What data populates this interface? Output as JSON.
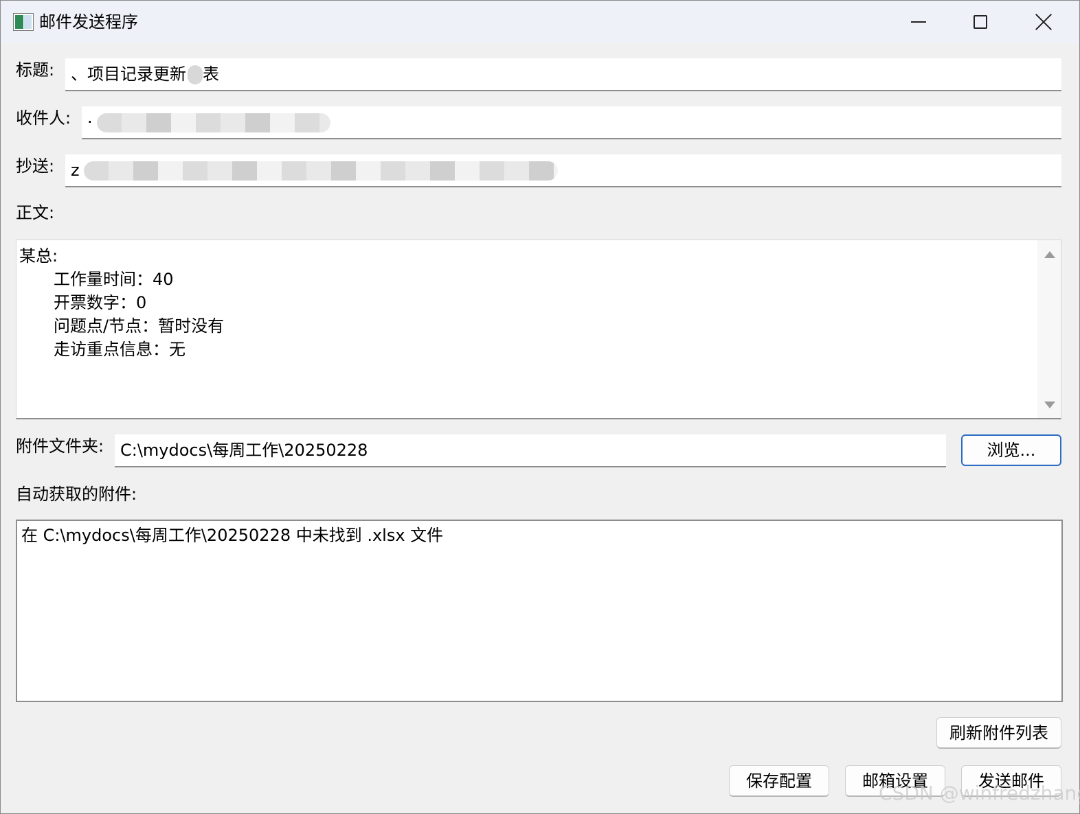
{
  "window": {
    "title": "邮件发送程序",
    "icon": "app-window-icon",
    "controls": [
      "minimize-icon",
      "maximize-icon",
      "close-icon"
    ]
  },
  "form": {
    "subject_label": "标题:",
    "subject_value": "、项目记录更新",
    "subject_tail": "表",
    "recipient_label": "收件人:",
    "recipient_value": "·",
    "cc_label": "抄送:",
    "cc_value": "z",
    "body_label": "正文:",
    "body_lines": [
      "某总:",
      "工作量时间：40",
      "开票数字：0",
      "问题点/节点：暂时没有",
      "走访重点信息：无"
    ],
    "attachment_folder_label": "附件文件夹:",
    "attachment_folder_value": "C:\\mydocs\\每周工作\\20250228",
    "browse_button": "浏览...",
    "auto_attachments_label": "自动获取的附件:",
    "attachments_list": [
      "在 C:\\mydocs\\每周工作\\20250228 中未找到 .xlsx 文件"
    ]
  },
  "buttons": {
    "refresh": "刷新附件列表",
    "save_config": "保存配置",
    "mail_settings": "邮箱设置",
    "send": "发送邮件"
  },
  "watermark": "CSDN @winfredzhang"
}
